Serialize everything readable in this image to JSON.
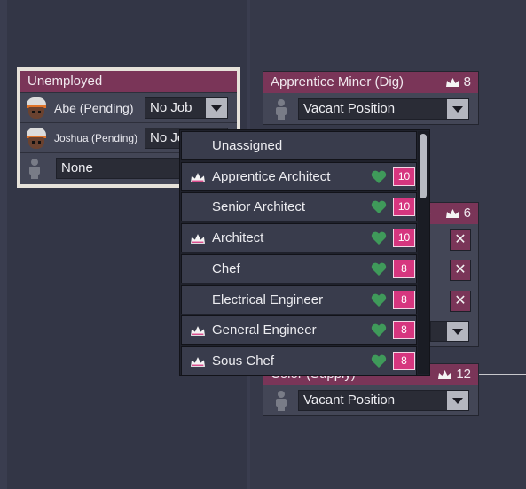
{
  "unemployed": {
    "title": "Unemployed",
    "rows": [
      {
        "name": "Abe (Pending)",
        "job": "No Job"
      },
      {
        "name": "Joshua (Pending)",
        "job": "No Jo"
      },
      {
        "name": "",
        "job": "None"
      }
    ]
  },
  "cards": {
    "miner": {
      "title": "Apprentice Miner (Dig)",
      "count": "8",
      "slot": "Vacant Position"
    },
    "middle": {
      "count": "6"
    },
    "supply": {
      "title": "Color (Supply)",
      "count": "12",
      "slot": "Vacant Position"
    }
  },
  "dropdown": {
    "options": [
      {
        "label": "Unassigned",
        "crown": false,
        "heart": false,
        "score": ""
      },
      {
        "label": "Apprentice Architect",
        "crown": true,
        "heart": true,
        "score": "10"
      },
      {
        "label": "Senior Architect",
        "crown": false,
        "heart": true,
        "score": "10"
      },
      {
        "label": "Architect",
        "crown": true,
        "heart": true,
        "score": "10"
      },
      {
        "label": "Chef",
        "crown": false,
        "heart": true,
        "score": "8"
      },
      {
        "label": "Electrical Engineer",
        "crown": false,
        "heart": true,
        "score": "8"
      },
      {
        "label": "General Engineer",
        "crown": true,
        "heart": true,
        "score": "8"
      },
      {
        "label": "Sous Chef",
        "crown": true,
        "heart": true,
        "score": "8"
      }
    ]
  },
  "icons": {
    "crown": "crown-icon",
    "heart": "heart-icon",
    "close": "close-icon",
    "dropdown_arrow": "chevron-down-icon",
    "person": "person-silhouette-icon"
  },
  "colors": {
    "header": "#7a3558",
    "score_badge": "#d6367f",
    "heart": "#3f9a5a"
  }
}
